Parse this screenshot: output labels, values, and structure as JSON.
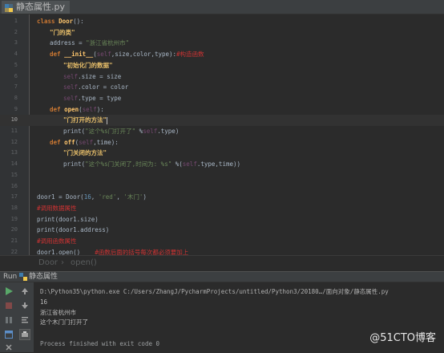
{
  "tab": {
    "filename": "静态属性.py"
  },
  "editor": {
    "lines": [
      {
        "n": "1"
      },
      {
        "n": "2"
      },
      {
        "n": "3"
      },
      {
        "n": "4"
      },
      {
        "n": "5"
      },
      {
        "n": "6"
      },
      {
        "n": "7"
      },
      {
        "n": "8"
      },
      {
        "n": "9"
      },
      {
        "n": "10"
      },
      {
        "n": "11"
      },
      {
        "n": "12"
      },
      {
        "n": "13"
      },
      {
        "n": "14"
      },
      {
        "n": "15"
      },
      {
        "n": "16"
      },
      {
        "n": "17"
      },
      {
        "n": "18"
      },
      {
        "n": "19"
      },
      {
        "n": "20"
      },
      {
        "n": "21"
      },
      {
        "n": "22"
      }
    ],
    "code": {
      "l1_kw": "class ",
      "l1_name": "Door",
      "l1_rest": "():",
      "l2_doc": "\"门的类\"",
      "l3_a": "address = ",
      "l3_str": "\"浙江省杭州市\"",
      "l4_kw": "def ",
      "l4_fn": "__init__",
      "l4_p": "(",
      "l4_self": "self",
      "l4_args": ",size,color,type):",
      "l4_cmt": "#构造函数",
      "l5_doc": "\"初始化门的数据\"",
      "l6_self": "self",
      "l6_rest": ".size = size",
      "l7_self": "self",
      "l7_rest": ".color = color",
      "l8_self": "self",
      "l8_rest": ".type = type",
      "l9_kw": "def ",
      "l9_fn": "open",
      "l9_p": "(",
      "l9_self": "self",
      "l9_e": "):",
      "l10_doc": "\"门打开的方法\"",
      "l11_a": "print(",
      "l11_str": "\"这个%s门打开了\"",
      "l11_b": " %",
      "l11_self": "self",
      "l11_c": ".type)",
      "l12_kw": "def ",
      "l12_fn": "off",
      "l12_p": "(",
      "l12_self": "self",
      "l12_e": ",time):",
      "l13_doc": "\"门关闭的方法\"",
      "l14_a": "print(",
      "l14_str": "\"这个%s门关闭了,时间为: %s\"",
      "l14_b": " %(",
      "l14_self": "self",
      "l14_c": ".type,time))",
      "l17_a": "door1 = Door(",
      "l17_num": "16",
      "l17_b": ", ",
      "l17_s1": "'red'",
      "l17_c": ", ",
      "l17_s2": "'木门'",
      "l17_d": ")",
      "l18_cmt": "#调用数据属性",
      "l19": "print(door1.size)",
      "l20": "print(door1.address)",
      "l21_cmt": "#调用函数属性",
      "l22_a": "door1.open()",
      "l22_cmt": "#函数后面的括号每次都必须要加上"
    }
  },
  "breadcrumb": {
    "item1": "Door",
    "item2": "open()"
  },
  "run": {
    "label": "Run",
    "config": "静态属性"
  },
  "console": {
    "cmd": "D:\\Python35\\python.exe C:/Users/ZhangJ/PycharmProjects/untitled/Python3/20180…/面向对象/静态属性.py",
    "out1": "16",
    "out2": "浙江省杭州市",
    "out3": "这个木门门打开了",
    "exit": "Process finished with exit code 0"
  },
  "watermark": "@51CTO博客",
  "colors": {
    "keyword": "#cc7832",
    "function": "#ffc66d",
    "string": "#6a8759",
    "docstring": "#e8bf6a",
    "comment": "#cc3333",
    "self": "#94558d",
    "number": "#6897bb"
  }
}
